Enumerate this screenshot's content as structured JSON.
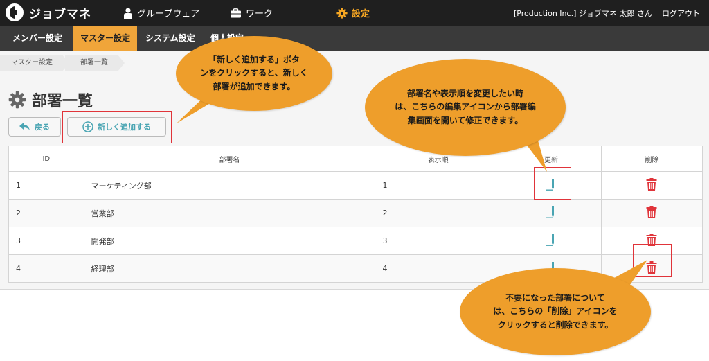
{
  "header": {
    "app_name": "ジョブマネ",
    "nav": [
      {
        "label": "グループウェア",
        "icon": "person-icon"
      },
      {
        "label": "ワーク",
        "icon": "briefcase-icon"
      },
      {
        "label": "設定",
        "icon": "gear-icon",
        "active": true
      }
    ],
    "user": "[Production Inc.] ジョブマネ 太郎 さん",
    "logout": "ログアウト"
  },
  "subnav": [
    "メンバー設定",
    "マスター設定",
    "システム設定",
    "個人設定"
  ],
  "breadcrumb": [
    "マスター設定",
    "部署一覧"
  ],
  "page": {
    "title": "部署一覧",
    "back_label": "戻る",
    "add_label": "新しく追加する"
  },
  "table": {
    "headers": [
      "ID",
      "部署名",
      "表示順",
      "更新",
      "削除"
    ],
    "rows": [
      {
        "id": "1",
        "name": "マーケティング部",
        "order": "1"
      },
      {
        "id": "2",
        "name": "営業部",
        "order": "2"
      },
      {
        "id": "3",
        "name": "開発部",
        "order": "3"
      },
      {
        "id": "4",
        "name": "経理部",
        "order": "4"
      }
    ]
  },
  "callouts": {
    "add": [
      "「新しく追加する」ボタ",
      "ンをクリックすると、新しく",
      "部署が追加できます。"
    ],
    "edit": [
      "部署名や表示順を変更したい時",
      "は、こちらの編集アイコンから部署編",
      "集画面を開いて修正できます。"
    ],
    "delete": [
      "不要になった部署について",
      "は、こちらの「削除」アイコンを",
      "クリックすると削除できます。"
    ]
  },
  "colors": {
    "accent": "#f0a53a",
    "edit_icon": "#4aa5b3",
    "delete_icon": "#e0343a",
    "highlight": "#e0343a",
    "bubble": "#ee9e2b"
  }
}
